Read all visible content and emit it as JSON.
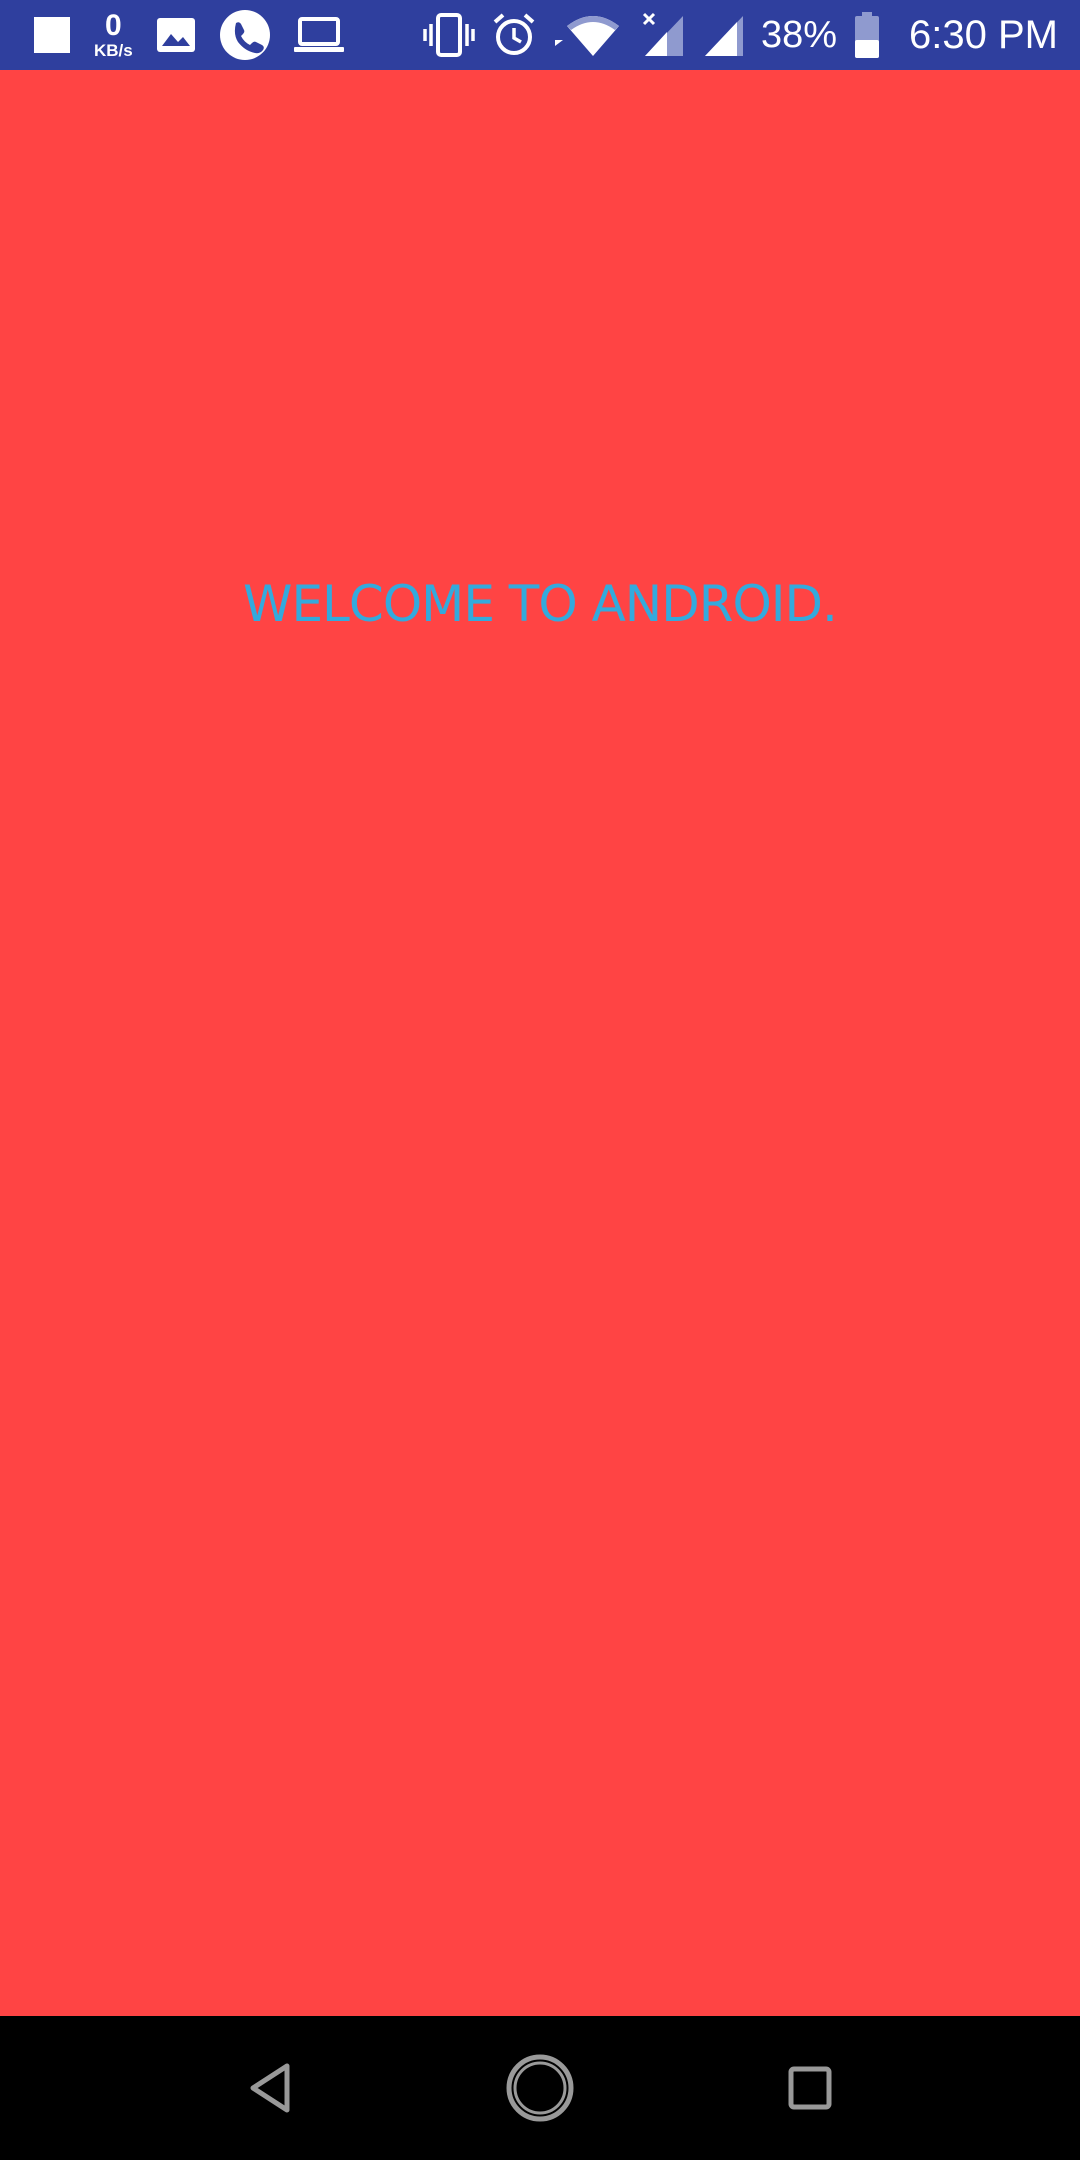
{
  "status_bar": {
    "background_color": "#2f3f9e",
    "network_speed_value": "0",
    "network_speed_unit": "KB/s",
    "battery_percent": "38%",
    "time": "6:30 PM",
    "icons_left": [
      "notification-square-icon",
      "image-icon",
      "phone-call-icon",
      "laptop-icon"
    ],
    "icons_right": [
      "vibrate-icon",
      "alarm-icon",
      "wifi-icon",
      "signal-no-data-icon",
      "signal-icon",
      "battery-icon"
    ]
  },
  "main": {
    "background_color": "#ff4444",
    "welcome_text": "WELCOME TO ANDROID.",
    "welcome_text_color": "#33aadd"
  },
  "nav_bar": {
    "background_color": "#000000",
    "buttons": [
      "back-icon",
      "home-icon",
      "recents-icon"
    ]
  }
}
